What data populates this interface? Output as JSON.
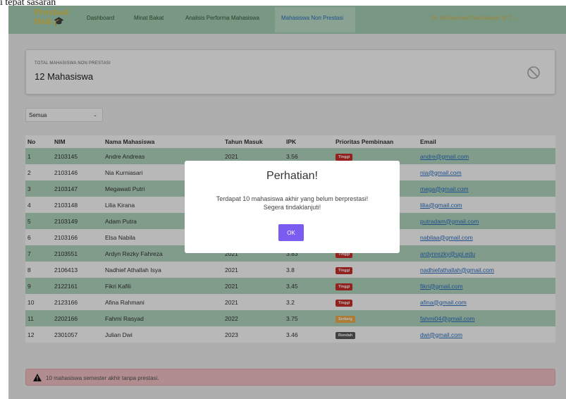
{
  "caption": "i tepat sasaran",
  "brand": {
    "line1": "Prestasi",
    "line2": "Hub"
  },
  "nav": {
    "items": [
      {
        "label": "Dashboard"
      },
      {
        "label": "Minat Bakat"
      },
      {
        "label": "Analisis Performa Mahasiswa"
      },
      {
        "label": "Mahasiswa Non Prestasi"
      }
    ],
    "user": "Dr. Muhammad Nurhidayat, M.T. ⌄"
  },
  "summary": {
    "label": "TOTAL MAHASISWA NON PRESTASI",
    "value": "12 Mahasiswa",
    "icon": "ban-icon"
  },
  "filter": {
    "selected": "Semua"
  },
  "table": {
    "headers": [
      "No",
      "NIM",
      "Nama Mahasiswa",
      "Tahun Masuk",
      "IPK",
      "Prioritas Pembinaan",
      "Email"
    ],
    "rows": [
      {
        "no": "1",
        "nim": "2103145",
        "nama": "Andre Andreas",
        "tahun": "2021",
        "ipk": "3.56",
        "prioritas": "Tinggi",
        "email": "andre@gmail.com"
      },
      {
        "no": "2",
        "nim": "2103146",
        "nama": "Nia Kurniasari",
        "tahun": "",
        "ipk": "",
        "prioritas": "",
        "email": "nia@gmail.com"
      },
      {
        "no": "3",
        "nim": "2103147",
        "nama": "Megawati Putri",
        "tahun": "",
        "ipk": "",
        "prioritas": "",
        "email": "mega@gmail.com"
      },
      {
        "no": "4",
        "nim": "2103148",
        "nama": "Lilia Kirana",
        "tahun": "",
        "ipk": "",
        "prioritas": "",
        "email": "lilia@gmail.com"
      },
      {
        "no": "5",
        "nim": "2103149",
        "nama": "Adam Putra",
        "tahun": "",
        "ipk": "",
        "prioritas": "",
        "email": "putradam@gmail.com"
      },
      {
        "no": "6",
        "nim": "2103166",
        "nama": "Elsa Nabila",
        "tahun": "",
        "ipk": "",
        "prioritas": "",
        "email": "nabilaa@gmail.com"
      },
      {
        "no": "7",
        "nim": "2103551",
        "nama": "Ardyn Rezky Fahreza",
        "tahun": "2021",
        "ipk": "3.83",
        "prioritas": "Tinggi",
        "email": "ardynrezky@upi.edu"
      },
      {
        "no": "8",
        "nim": "2106413",
        "nama": "Nadhief Athallah Isya",
        "tahun": "2021",
        "ipk": "3.8",
        "prioritas": "Tinggi",
        "email": "nadhiefathallah@gmail.com"
      },
      {
        "no": "9",
        "nim": "2122161",
        "nama": "Fikri Kafili",
        "tahun": "2021",
        "ipk": "3.45",
        "prioritas": "Tinggi",
        "email": "fikri@gmail.com"
      },
      {
        "no": "10",
        "nim": "2123166",
        "nama": "Afina Rahmani",
        "tahun": "2021",
        "ipk": "3.2",
        "prioritas": "Tinggi",
        "email": "afina@gmail.com"
      },
      {
        "no": "11",
        "nim": "2202166",
        "nama": "Fahmi Rasyad",
        "tahun": "2022",
        "ipk": "3.75",
        "prioritas": "Sedang",
        "email": "fahmi04@gmail.com"
      },
      {
        "no": "12",
        "nim": "2301057",
        "nama": "Julian Dwi",
        "tahun": "2023",
        "ipk": "3.46",
        "prioritas": "Rendah",
        "email": "dwi@gmail.com"
      }
    ]
  },
  "alert": {
    "text": "10 mahasiswa semester akhir tanpa prestasi.",
    "icon": "warning-icon"
  },
  "modal": {
    "title": "Perhatian!",
    "message_line1": "Terdapat 10 mahasiswa akhir yang belum berprestasi!",
    "message_line2": "Segera tindaklanjuti!",
    "ok_label": "OK"
  },
  "colors": {
    "navbar": "#a8d3b7",
    "row_alt": "#b5d9c3",
    "ok_button": "#7a5cf0",
    "tinggi": "#c9302c",
    "sedang": "#f0ad4e",
    "rendah": "#5b5b5b",
    "alert_bg": "#f5c4c7"
  }
}
